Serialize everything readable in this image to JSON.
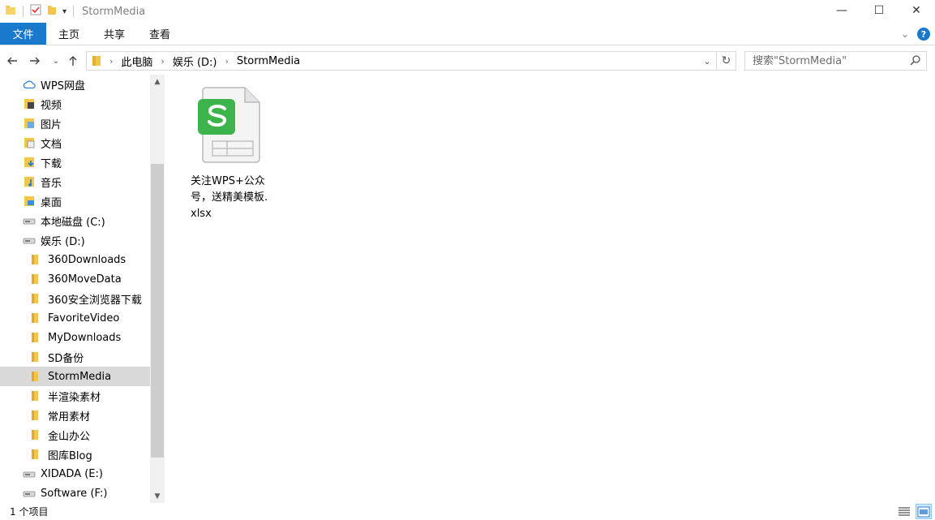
{
  "window": {
    "title": "StormMedia",
    "controls": {
      "minimize": "—",
      "maximize": "☐",
      "close": "✕"
    }
  },
  "ribbon": {
    "tabs": [
      {
        "label": "文件",
        "active": true
      },
      {
        "label": "主页"
      },
      {
        "label": "共享"
      },
      {
        "label": "查看"
      }
    ]
  },
  "address": {
    "crumbs": [
      "此电脑",
      "娱乐 (D:)",
      "StormMedia"
    ]
  },
  "search": {
    "placeholder": "搜索\"StormMedia\""
  },
  "nav": {
    "items": [
      {
        "label": "WPS网盘",
        "icon": "cloud-icon",
        "level": 1
      },
      {
        "label": "视频",
        "icon": "video-folder-icon",
        "level": 1
      },
      {
        "label": "图片",
        "icon": "pictures-folder-icon",
        "level": 1
      },
      {
        "label": "文档",
        "icon": "documents-folder-icon",
        "level": 1
      },
      {
        "label": "下载",
        "icon": "downloads-folder-icon",
        "level": 1
      },
      {
        "label": "音乐",
        "icon": "music-folder-icon",
        "level": 1
      },
      {
        "label": "桌面",
        "icon": "desktop-folder-icon",
        "level": 1
      },
      {
        "label": "本地磁盘 (C:)",
        "icon": "drive-icon",
        "level": 1
      },
      {
        "label": "娱乐 (D:)",
        "icon": "drive-icon",
        "level": 1
      },
      {
        "label": "360Downloads",
        "icon": "folder-icon",
        "level": 2
      },
      {
        "label": "360MoveData",
        "icon": "folder-icon",
        "level": 2
      },
      {
        "label": "360安全浏览器下载",
        "icon": "folder-icon",
        "level": 2
      },
      {
        "label": "FavoriteVideo",
        "icon": "folder-icon",
        "level": 2
      },
      {
        "label": "MyDownloads",
        "icon": "folder-icon",
        "level": 2
      },
      {
        "label": "SD备份",
        "icon": "folder-icon",
        "level": 2
      },
      {
        "label": "StormMedia",
        "icon": "folder-icon",
        "level": 2,
        "selected": true
      },
      {
        "label": "半渲染素材",
        "icon": "folder-icon",
        "level": 2
      },
      {
        "label": "常用素材",
        "icon": "folder-icon",
        "level": 2
      },
      {
        "label": "金山办公",
        "icon": "folder-icon",
        "level": 2
      },
      {
        "label": "图库Blog",
        "icon": "folder-icon",
        "level": 2
      },
      {
        "label": "XIDADA (E:)",
        "icon": "drive-icon",
        "level": 1
      },
      {
        "label": "Software (F:)",
        "icon": "drive-icon",
        "level": 1
      }
    ]
  },
  "files": [
    {
      "name": "关注WPS+公众号，送精美模板.xlsx",
      "icon": "wps-spreadsheet-icon",
      "brand_color": "#3cb44b"
    }
  ],
  "status": {
    "count": "1 个项目"
  },
  "colors": {
    "accent": "#1979ca",
    "selection": "#d9d9d9",
    "folder": "#f5c44b"
  }
}
